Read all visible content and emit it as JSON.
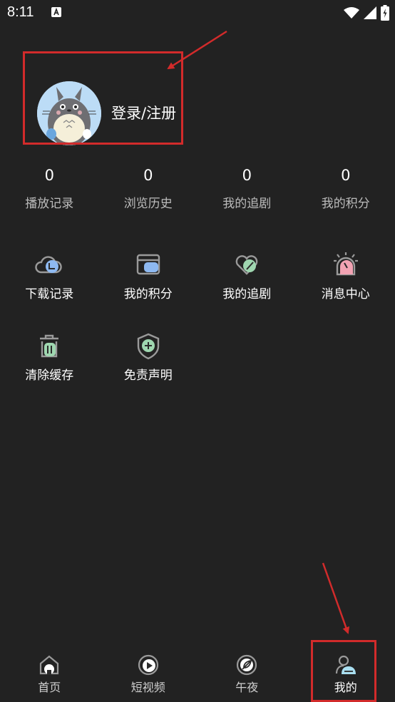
{
  "status_bar": {
    "time": "8:11"
  },
  "profile": {
    "login_label": "登录/注册"
  },
  "stats": [
    {
      "value": "0",
      "label": "播放记录"
    },
    {
      "value": "0",
      "label": "浏览历史"
    },
    {
      "value": "0",
      "label": "我的追剧"
    },
    {
      "value": "0",
      "label": "我的积分"
    }
  ],
  "menu": [
    {
      "label": "下载记录",
      "icon": "cloud-download-icon"
    },
    {
      "label": "我的积分",
      "icon": "wallet-icon"
    },
    {
      "label": "我的追剧",
      "icon": "heart-icon"
    },
    {
      "label": "消息中心",
      "icon": "alarm-bell-icon"
    },
    {
      "label": "清除缓存",
      "icon": "trash-icon"
    },
    {
      "label": "免责声明",
      "icon": "shield-icon"
    }
  ],
  "tabs": [
    {
      "label": "首页",
      "icon": "home-icon"
    },
    {
      "label": "短视频",
      "icon": "play-icon"
    },
    {
      "label": "午夜",
      "icon": "leaf-icon"
    },
    {
      "label": "我的",
      "icon": "user-icon",
      "active": true
    }
  ],
  "colors": {
    "background": "#222222",
    "annotation": "#d22b2b",
    "accent_blue": "#8eb9f1",
    "accent_green": "#9fd7b0",
    "accent_pink": "#f2a3b3",
    "accent_cyan": "#a9dff0"
  }
}
